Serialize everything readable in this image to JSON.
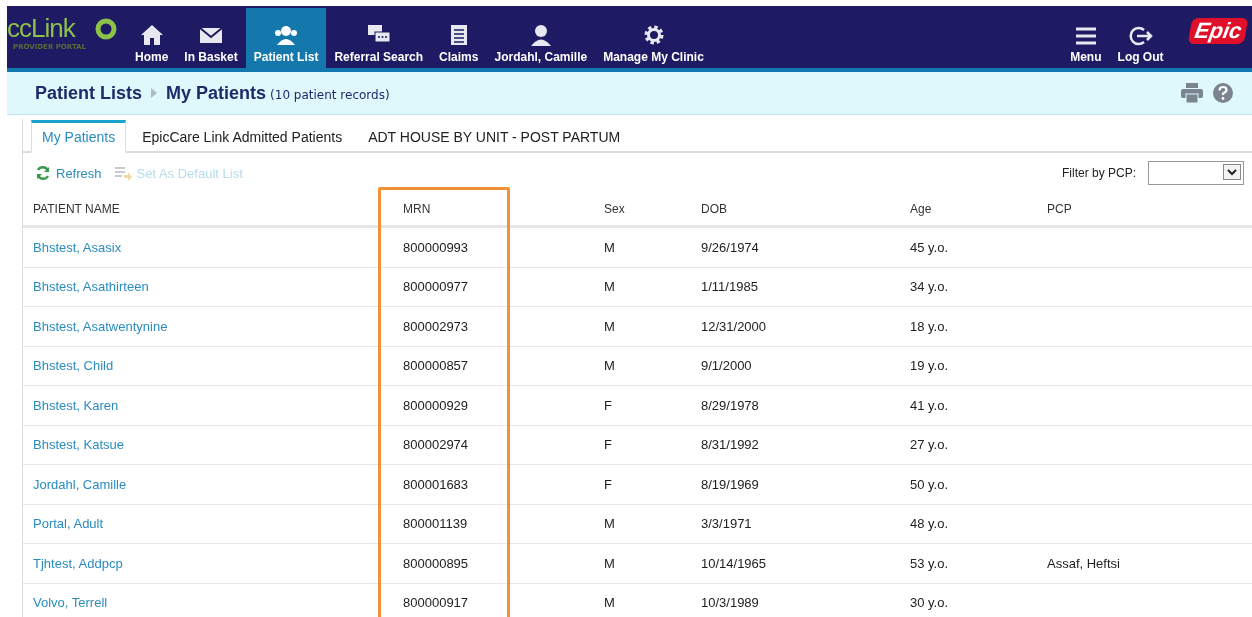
{
  "logo": {
    "name": "ccLink",
    "subtitle": "PROVIDER PORTAL"
  },
  "nav": [
    {
      "label": "Home",
      "kind": "home",
      "selected": false
    },
    {
      "label": "In Basket",
      "kind": "mail",
      "selected": false
    },
    {
      "label": "Patient List",
      "kind": "people",
      "selected": true
    },
    {
      "label": "Referral Search",
      "kind": "chat",
      "selected": false
    },
    {
      "label": "Claims",
      "kind": "doc",
      "selected": false
    },
    {
      "label": "Jordahl, Camille",
      "kind": "person",
      "selected": false
    },
    {
      "label": "Manage My Clinic",
      "kind": "gear",
      "selected": false
    }
  ],
  "nav_right": [
    {
      "label": "Menu",
      "kind": "menu"
    },
    {
      "label": "Log Out",
      "kind": "logout"
    }
  ],
  "brand": "Epic",
  "breadcrumb": {
    "parent": "Patient Lists",
    "current": "My Patients",
    "count": "(10 patient records)"
  },
  "tabs": [
    {
      "label": "My Patients",
      "selected": true
    },
    {
      "label": "EpicCare Link Admitted Patients",
      "selected": false
    },
    {
      "label": "ADT HOUSE BY UNIT - POST PARTUM",
      "selected": false
    }
  ],
  "toolbar": [
    {
      "label": "Refresh",
      "kind": "refresh",
      "disabled": false
    },
    {
      "label": "Set As Default List",
      "kind": "list",
      "disabled": true
    }
  ],
  "filter": {
    "label": "Filter by PCP:"
  },
  "table": {
    "columns": [
      {
        "label": "PATIENT NAME",
        "highlighted": false
      },
      {
        "label": "MRN",
        "highlighted": true
      },
      {
        "label": "Sex",
        "highlighted": false
      },
      {
        "label": "DOB",
        "highlighted": false
      },
      {
        "label": "Age",
        "highlighted": false
      },
      {
        "label": "PCP",
        "highlighted": false
      }
    ],
    "rows": [
      [
        "Bhstest, Asasix",
        "800000993",
        "M",
        "9/26/1974",
        "45 y.o.",
        ""
      ],
      [
        "Bhstest, Asathirteen",
        "800000977",
        "M",
        "1/11/1985",
        "34 y.o.",
        ""
      ],
      [
        "Bhstest, Asatwentynine",
        "800002973",
        "M",
        "12/31/2000",
        "18 y.o.",
        ""
      ],
      [
        "Bhstest, Child",
        "800000857",
        "M",
        "9/1/2000",
        "19 y.o.",
        ""
      ],
      [
        "Bhstest, Karen",
        "800000929",
        "F",
        "8/29/1978",
        "41 y.o.",
        ""
      ],
      [
        "Bhstest, Katsue",
        "800002974",
        "F",
        "8/31/1992",
        "27 y.o.",
        ""
      ],
      [
        "Jordahl, Camille",
        "800001683",
        "F",
        "8/19/1969",
        "50 y.o.",
        ""
      ],
      [
        "Portal, Adult",
        "800001139",
        "M",
        "3/3/1971",
        "48 y.o.",
        ""
      ],
      [
        "Tjhtest, Addpcp",
        "800000895",
        "M",
        "10/14/1965",
        "53 y.o.",
        "Assaf, Heftsi"
      ],
      [
        "Volvo, Terrell",
        "800000917",
        "M",
        "10/3/1989",
        "30 y.o.",
        ""
      ]
    ]
  }
}
